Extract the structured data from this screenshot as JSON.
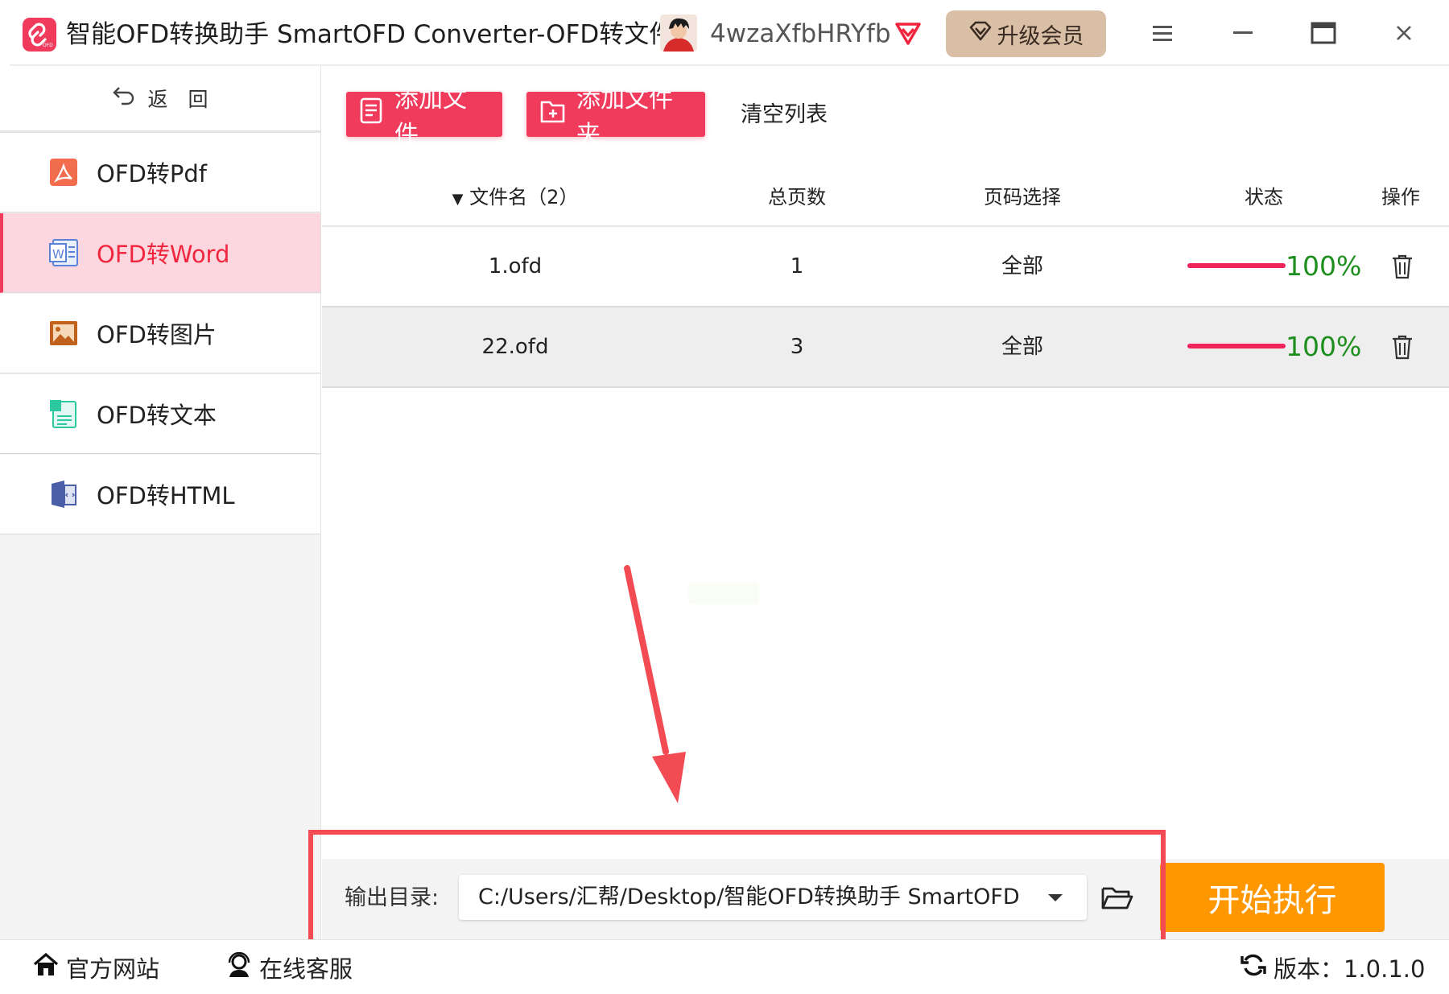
{
  "window": {
    "title": "智能OFD转换助手 SmartOFD Converter-OFD转文件",
    "username": "4wzaXfbHRYfb",
    "upgrade_label": "升级会员"
  },
  "sidebar": {
    "back_label": "返　回",
    "items": [
      {
        "label": "OFD转Pdf",
        "icon": "pdf-icon",
        "active": false
      },
      {
        "label": "OFD转Word",
        "icon": "word-icon",
        "active": true
      },
      {
        "label": "OFD转图片",
        "icon": "image-icon",
        "active": false
      },
      {
        "label": "OFD转文本",
        "icon": "text-icon",
        "active": false
      },
      {
        "label": "OFD转HTML",
        "icon": "html-icon",
        "active": false
      }
    ]
  },
  "toolbar": {
    "add_file": "添加文件",
    "add_folder": "添加文件夹",
    "clear_list": "清空列表"
  },
  "table": {
    "columns": [
      "文件名（2）",
      "总页数",
      "页码选择",
      "状态",
      "操作"
    ],
    "rows": [
      {
        "name": "1.ofd",
        "pages": "1",
        "range": "全部",
        "progress": 1.0,
        "status": "100%"
      },
      {
        "name": "22.ofd",
        "pages": "3",
        "range": "全部",
        "progress": 1.0,
        "status": "100%"
      }
    ]
  },
  "output": {
    "label": "输出目录:",
    "value": "C:/Users/汇帮/Desktop/智能OFD转换助手 SmartOFD"
  },
  "start_button": "开始执行",
  "footer": {
    "website": "官方网站",
    "support": "在线客服",
    "version": "版本：1.0.1.0"
  },
  "colors": {
    "accent": "#f03b5d",
    "start": "#ff9700",
    "progress": "#f0245b",
    "status_text": "#1e8f1e",
    "annotation": "#f34b54"
  }
}
